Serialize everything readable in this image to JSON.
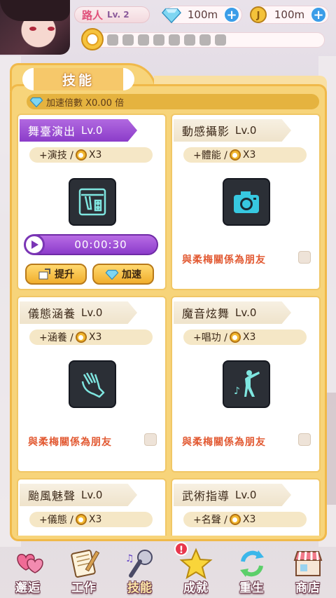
{
  "player": {
    "name": "路人",
    "level": "Lv. 2"
  },
  "currency": {
    "gems": "100m",
    "coins": "100m"
  },
  "panel": {
    "title": "技能",
    "speed_multiplier_text": "加速倍數 X0.00 倍"
  },
  "skills": [
    {
      "name": "舞臺演出",
      "level": "Lv.0",
      "stat": "+演技 /",
      "multiplier": "X3",
      "icon": "stage-icon",
      "active": true,
      "timer": "00:00:30",
      "upgrade_label": "提升",
      "speedup_label": "加速"
    },
    {
      "name": "動感攝影",
      "level": "Lv.0",
      "stat": "+體能 /",
      "multiplier": "X3",
      "icon": "camera-icon",
      "condition": "與柔梅關係為朋友"
    },
    {
      "name": "儀態涵養",
      "level": "Lv.0",
      "stat": "+涵養 /",
      "multiplier": "X3",
      "icon": "glove-icon",
      "condition": "與柔梅關係為朋友"
    },
    {
      "name": "魔音炫舞",
      "level": "Lv.0",
      "stat": "+唱功 /",
      "multiplier": "X3",
      "icon": "dancer-icon",
      "condition": "與柔梅關係為朋友"
    },
    {
      "name": "颱風魅聲",
      "level": "Lv.0",
      "stat": "+儀態 /",
      "multiplier": "X3"
    },
    {
      "name": "武術指導",
      "level": "Lv.0",
      "stat": "+名聲 /",
      "multiplier": "X3"
    }
  ],
  "nav": [
    {
      "label": "邂逅",
      "icon": "hearts-icon"
    },
    {
      "label": "工作",
      "icon": "notebook-icon"
    },
    {
      "label": "技能",
      "icon": "microphone-icon",
      "active": true
    },
    {
      "label": "成就",
      "icon": "star-icon",
      "badge": "!"
    },
    {
      "label": "重生",
      "icon": "refresh-icon"
    },
    {
      "label": "商店",
      "icon": "shop-icon"
    }
  ],
  "colors": {
    "panel": "#f7d47a",
    "active_skill": "#8b3cc9",
    "condition_text": "#e25a33",
    "plus_button": "#3b9de8"
  }
}
